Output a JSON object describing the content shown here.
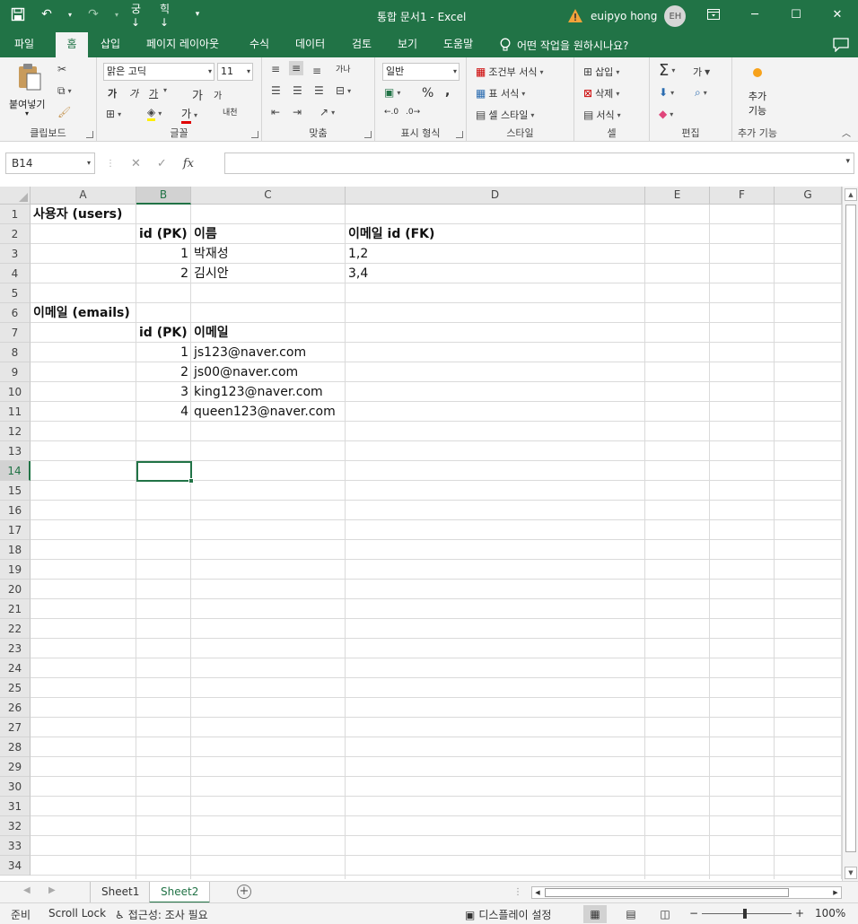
{
  "titlebar": {
    "title": "통합 문서1  -  Excel",
    "user_name": "euipyo hong",
    "avatar_initials": "EH"
  },
  "tabs": [
    {
      "label": "파일",
      "active": false
    },
    {
      "label": "홈",
      "active": true
    },
    {
      "label": "삽입",
      "active": false
    },
    {
      "label": "페이지 레이아웃",
      "active": false
    },
    {
      "label": "수식",
      "active": false
    },
    {
      "label": "데이터",
      "active": false
    },
    {
      "label": "검토",
      "active": false
    },
    {
      "label": "보기",
      "active": false
    },
    {
      "label": "도움말",
      "active": false
    }
  ],
  "tell_me": "어떤 작업을 원하시나요?",
  "ribbon": {
    "clipboard": {
      "label": "클립보드",
      "paste": "붙여넣기"
    },
    "font": {
      "label": "글꼴",
      "font_name": "맑은 고딕",
      "font_size": "11",
      "grow": "가",
      "shrink": "가",
      "bold": "가",
      "italic": "가",
      "underline": "가",
      "font_color": "가",
      "phonetic": "내천"
    },
    "alignment": {
      "label": "맞춤",
      "wrap": "가나"
    },
    "number": {
      "label": "표시 형식",
      "format": "일반",
      "percent": "%",
      "comma": ","
    },
    "styles": {
      "label": "스타일",
      "conditional": "조건부 서식",
      "table": "표 서식",
      "cell_style": "셀 스타일"
    },
    "cells": {
      "label": "셀",
      "insert": "삽입",
      "delete": "삭제",
      "format": "서식"
    },
    "editing": {
      "label": "편집",
      "sort": "가"
    },
    "addins": {
      "label": "추가 기능",
      "button_line1": "추가",
      "button_line2": "기능"
    }
  },
  "formula_bar": {
    "name_box": "B14",
    "formula": "",
    "fx": "fx"
  },
  "columns": [
    "A",
    "B",
    "C",
    "D",
    "E",
    "F",
    "G"
  ],
  "selected_column": "B",
  "rows": [
    "1",
    "2",
    "3",
    "4",
    "5",
    "6",
    "7",
    "8",
    "9",
    "10",
    "11",
    "12",
    "13",
    "14",
    "15",
    "16",
    "17",
    "18",
    "19",
    "20",
    "21",
    "22",
    "23",
    "24",
    "25",
    "26",
    "27",
    "28",
    "29",
    "30",
    "31",
    "32",
    "33",
    "34"
  ],
  "selected_row": "14",
  "cells": {
    "A1": "사용자 (users)",
    "B2": "id (PK)",
    "C2": "이름",
    "D2": "이메일 id (FK)",
    "B3": "1",
    "C3": "박재성",
    "D3": "1,2",
    "B4": "2",
    "C4": "김시안",
    "D4": "3,4",
    "A6": "이메일 (emails)",
    "B7": "id (PK)",
    "C7": "이메일",
    "B8": "1",
    "C8": "js123@naver.com",
    "B9": "2",
    "C9": "js00@naver.com",
    "B10": "3",
    "C10": "king123@naver.com",
    "B11": "4",
    "C11": "queen123@naver.com"
  },
  "sheets": [
    {
      "name": "Sheet1",
      "active": false
    },
    {
      "name": "Sheet2",
      "active": true
    }
  ],
  "status": {
    "ready": "준비",
    "scroll_lock": "Scroll Lock",
    "accessibility": "접근성: 조사 필요",
    "display_settings": "디스플레이 설정",
    "zoom": "100%",
    "zoom_minus": "−",
    "zoom_plus": "+"
  },
  "colors": {
    "accent": "#217346",
    "warning": "#f2a33a"
  }
}
